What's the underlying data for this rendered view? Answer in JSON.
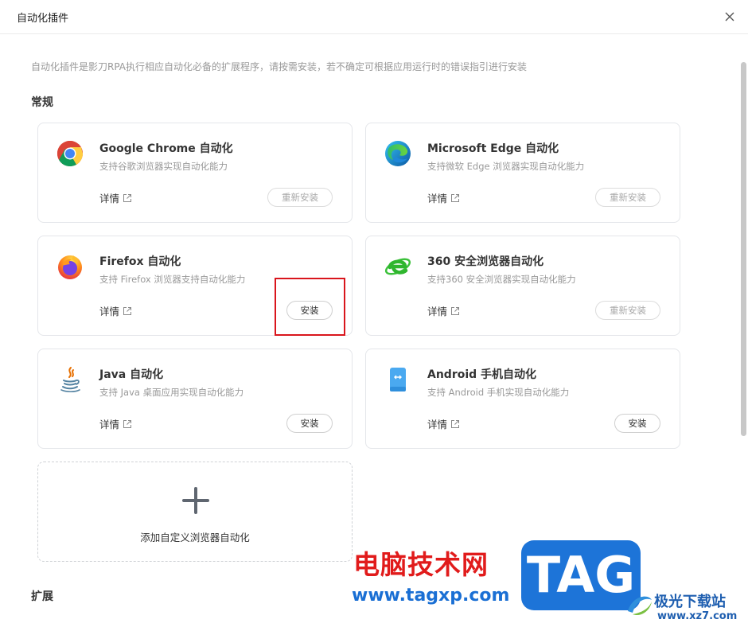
{
  "window": {
    "title": "自动化插件",
    "close_icon": "close-icon"
  },
  "description": "自动化插件是影刀RPA执行相应自动化必备的扩展程序，请按需安装，若不确定可根据应用运行时的错误指引进行安装",
  "sections": {
    "general": "常规",
    "extension": "扩展"
  },
  "plugins": [
    {
      "name": "Google Chrome 自动化",
      "desc": "支持谷歌浏览器实现自动化能力",
      "detail": "详情",
      "action": "重新安装",
      "icon": "chrome-icon"
    },
    {
      "name": "Microsoft Edge 自动化",
      "desc": "支持微软 Edge 浏览器实现自动化能力",
      "detail": "详情",
      "action": "重新安装",
      "icon": "edge-icon"
    },
    {
      "name": "Firefox 自动化",
      "desc": "支持 Firefox 浏览器支持自动化能力",
      "detail": "详情",
      "action": "安装",
      "icon": "firefox-icon"
    },
    {
      "name": "360 安全浏览器自动化",
      "desc": "支持360 安全浏览器实现自动化能力",
      "detail": "详情",
      "action": "重新安装",
      "icon": "360-browser-icon"
    },
    {
      "name": "Java 自动化",
      "desc": "支持 Java 桌面应用实现自动化能力",
      "detail": "详情",
      "action": "安装",
      "icon": "java-icon"
    },
    {
      "name": "Android 手机自动化",
      "desc": "支持 Android 手机实现自动化能力",
      "detail": "详情",
      "action": "安装",
      "icon": "android-phone-icon"
    }
  ],
  "add_custom": {
    "label": "添加自定义浏览器自动化",
    "icon": "plus-icon"
  },
  "watermark": {
    "cn_title": "电脑技术网",
    "url": "www.tagxp.com",
    "tag": "TAG",
    "site_cn": "极光下载站",
    "site_url": "www.xz7.com"
  },
  "colors": {
    "highlight": "#d9151c",
    "watermark_red": "#e11b1b",
    "watermark_blue": "#1d74d8"
  }
}
